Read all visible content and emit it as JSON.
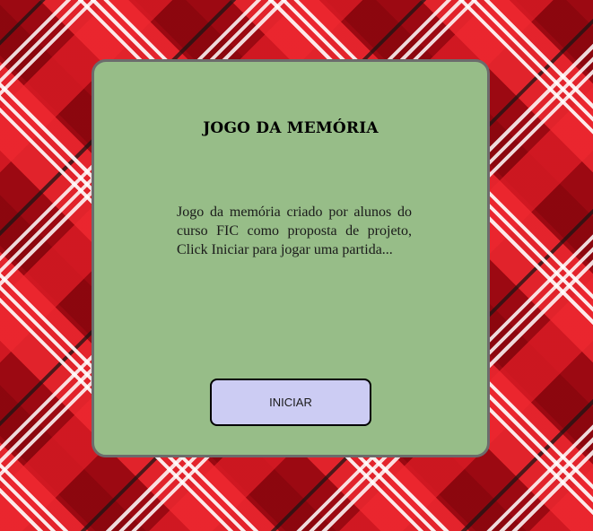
{
  "colors": {
    "card_background": "#97bd88",
    "card_border": "#6c6c6c",
    "button_background": "#ccccf3",
    "background_red": "#a10a14"
  },
  "card": {
    "title": "JOGO DA MEMÓRIA",
    "description": "Jogo da memória criado por alunos do curso FIC como proposta de projeto, Click Iniciar para jogar uma partida...",
    "start_button_label": "INICIAR"
  }
}
